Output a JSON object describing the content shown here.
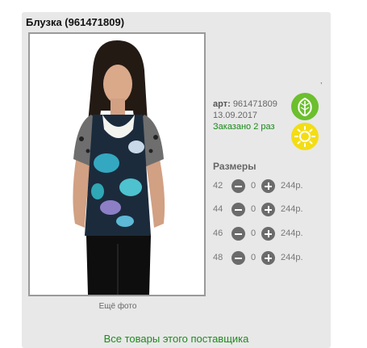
{
  "product": {
    "title": "Блузка (961471809)",
    "art_label": "арт:",
    "art_value": "961471809",
    "date": "13.09.2017",
    "ordered": "Заказано 2 раз",
    "more_photos": "Ещё фото",
    "stray_mark": ","
  },
  "icons": {
    "leaf": "leaf-icon",
    "sun": "sun-icon"
  },
  "sizes": {
    "title": "Размеры",
    "rows": [
      {
        "size": "42",
        "qty": "0",
        "price": "244р."
      },
      {
        "size": "44",
        "qty": "0",
        "price": "244р."
      },
      {
        "size": "46",
        "qty": "0",
        "price": "244р."
      },
      {
        "size": "48",
        "qty": "0",
        "price": "244р."
      }
    ]
  },
  "footer": {
    "supplier_link": "Все товары этого поставщика"
  },
  "colors": {
    "accent_green": "#1f8a1f",
    "leaf_green": "#6cbf2d",
    "sun_yellow": "#f3dd15",
    "panel_gray": "#e8e8e8"
  }
}
